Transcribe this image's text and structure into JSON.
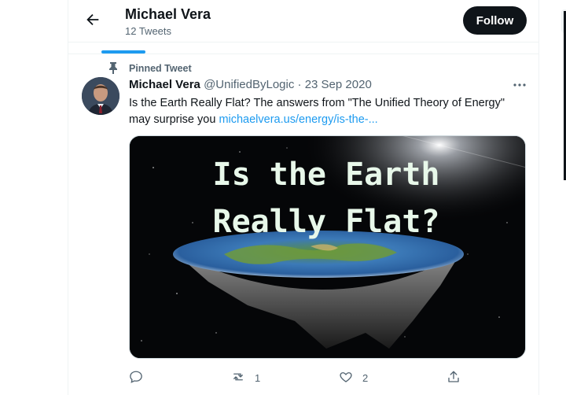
{
  "header": {
    "title": "Michael Vera",
    "subtitle": "12 Tweets",
    "follow_label": "Follow"
  },
  "tweet": {
    "pinned_label": "Pinned Tweet",
    "author_name": "Michael Vera",
    "author_handle": "@UnifiedByLogic",
    "dot": "·",
    "date": "23 Sep 2020",
    "text": "Is the Earth Really Flat? The answers from \"The Unified Theory of Energy\" may surprise you ",
    "link": "michaelvera.us/energy/is-the-...",
    "media_text_line1": "Is the Earth",
    "media_text_line2": "Really Flat?",
    "reply_count": "",
    "retweet_count": "1",
    "like_count": "2"
  },
  "colors": {
    "accent": "#1d9bf0",
    "text": "#0f1419",
    "muted": "#536471",
    "media_text": "#e8f8ea"
  }
}
